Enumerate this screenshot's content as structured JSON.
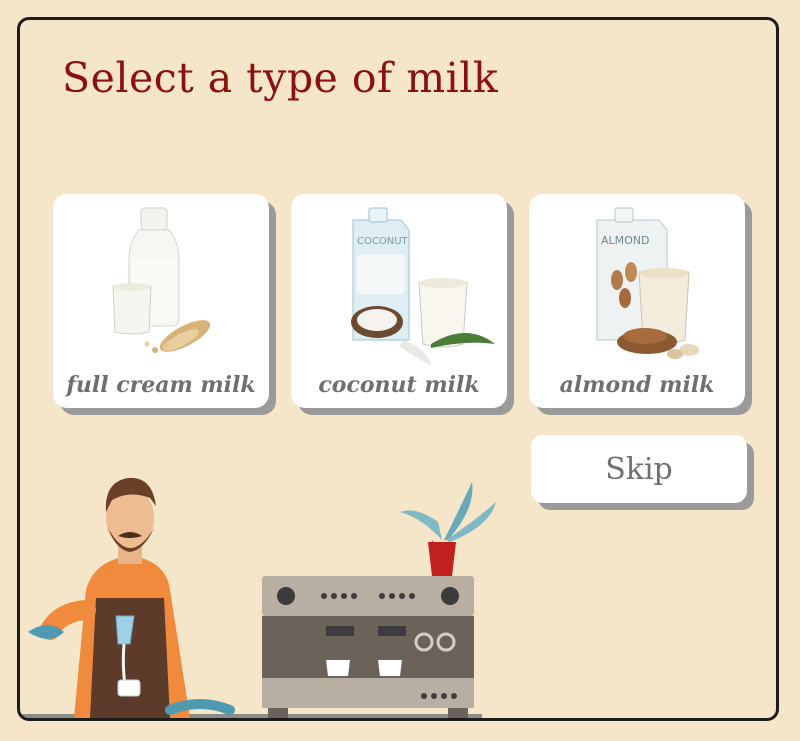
{
  "page": {
    "title": "Select a type of milk"
  },
  "options": [
    {
      "label": "full cream milk",
      "icon": "milk-bottle-icon"
    },
    {
      "label": "coconut milk",
      "icon": "coconut-milk-carton-icon"
    },
    {
      "label": "almond milk",
      "icon": "almond-milk-carton-icon"
    }
  ],
  "skip": {
    "label": "Skip"
  },
  "colors": {
    "title": "#8b1010",
    "background": "#f6e6c9",
    "card": "#ffffff",
    "shadow": "#9a9a9a",
    "label": "#6f6f6f"
  }
}
